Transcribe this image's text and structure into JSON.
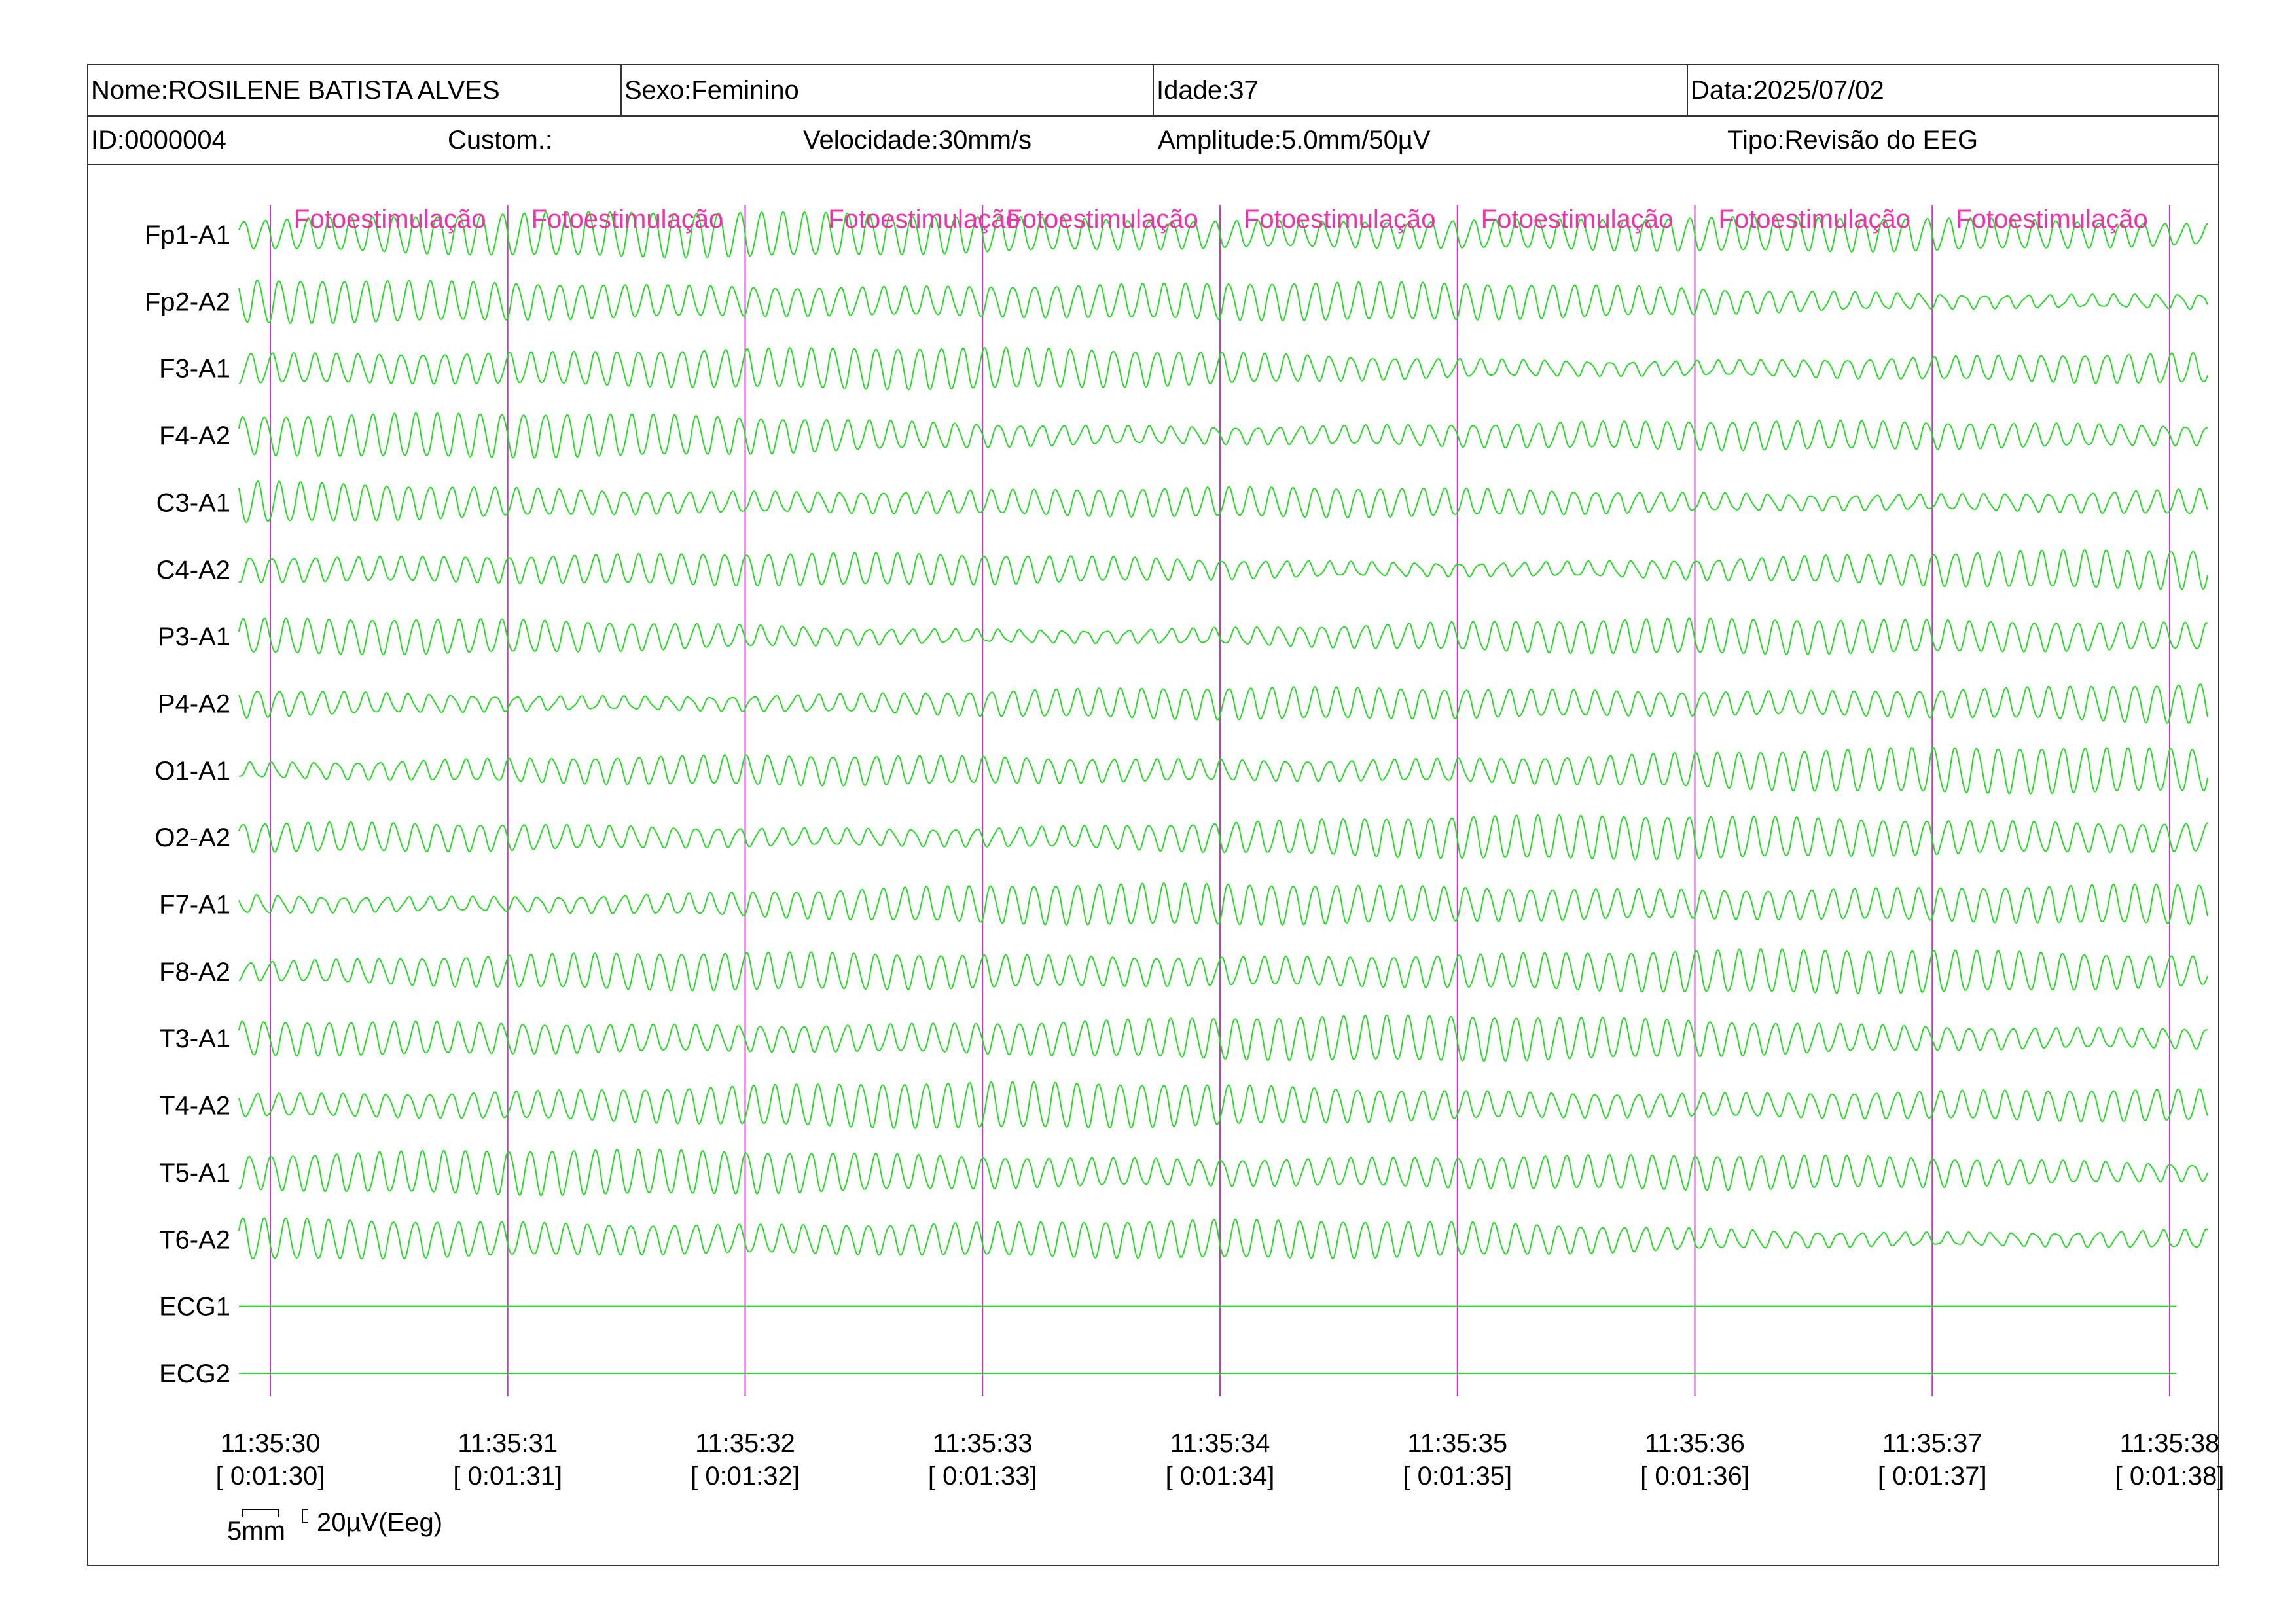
{
  "header": {
    "nome": "Nome:ROSILENE BATISTA ALVES",
    "sexo": "Sexo:Feminino",
    "idade": "Idade:37",
    "data": "Data:2025/07/02",
    "id": "ID:0000004",
    "custom": "Custom.:",
    "velocidade": "Velocidade:30mm/s",
    "amplitude": "Amplitude:5.0mm/50µV",
    "tipo": "Tipo:Revisão do EEG"
  },
  "scale_bar": {
    "time_label": "5mm",
    "amplitude_label": "20µV(Eeg)"
  },
  "colors": {
    "trace": "#22dd22",
    "marker": "#cc33cc",
    "marker_text": "#ee33aa",
    "border": "#333333"
  },
  "chart_data": {
    "type": "line",
    "channels": [
      "Fp1-A1",
      "Fp2-A2",
      "F3-A1",
      "F4-A2",
      "C3-A1",
      "C4-A2",
      "P3-A1",
      "P4-A2",
      "O1-A1",
      "O2-A2",
      "F7-A1",
      "F8-A2",
      "T3-A1",
      "T4-A2",
      "T5-A1",
      "T6-A2",
      "ECG1",
      "ECG2"
    ],
    "time_ticks": [
      {
        "clock": "11:35:30",
        "elapsed": "[ 0:01:30]"
      },
      {
        "clock": "11:35:31",
        "elapsed": "[ 0:01:31]"
      },
      {
        "clock": "11:35:32",
        "elapsed": "[ 0:01:32]"
      },
      {
        "clock": "11:35:33",
        "elapsed": "[ 0:01:33]"
      },
      {
        "clock": "11:35:34",
        "elapsed": "[ 0:01:34]"
      },
      {
        "clock": "11:35:35",
        "elapsed": "[ 0:01:35]"
      },
      {
        "clock": "11:35:36",
        "elapsed": "[ 0:01:36]"
      },
      {
        "clock": "11:35:37",
        "elapsed": "[ 0:01:37]"
      },
      {
        "clock": "11:35:38",
        "elapsed": "[ 0:01:38]"
      }
    ],
    "event_markers": [
      {
        "second": 0.0,
        "label": "Fotoestimulação"
      },
      {
        "second": 1.0,
        "label": "Fotoestimulação"
      },
      {
        "second": 2.0,
        "label": ""
      },
      {
        "second": 3.0,
        "label": "Fotoestimulação"
      },
      {
        "second": 4.0,
        "label": "Fotoestimulação"
      },
      {
        "second": 5.0,
        "label": "Fotoestimulação"
      },
      {
        "second": 6.0,
        "label": "Fotoestimulação"
      },
      {
        "second": 7.0,
        "label": "Fotoestimulação"
      },
      {
        "second": 8.0,
        "label": ""
      }
    ],
    "extra_event_labels": [
      {
        "second": 2.25,
        "label": "Fotoestimulação"
      }
    ],
    "dominant_frequency_hz": 11,
    "flat_channels": [
      "ECG1",
      "ECG2"
    ],
    "duration_s": 8,
    "grid": false
  }
}
